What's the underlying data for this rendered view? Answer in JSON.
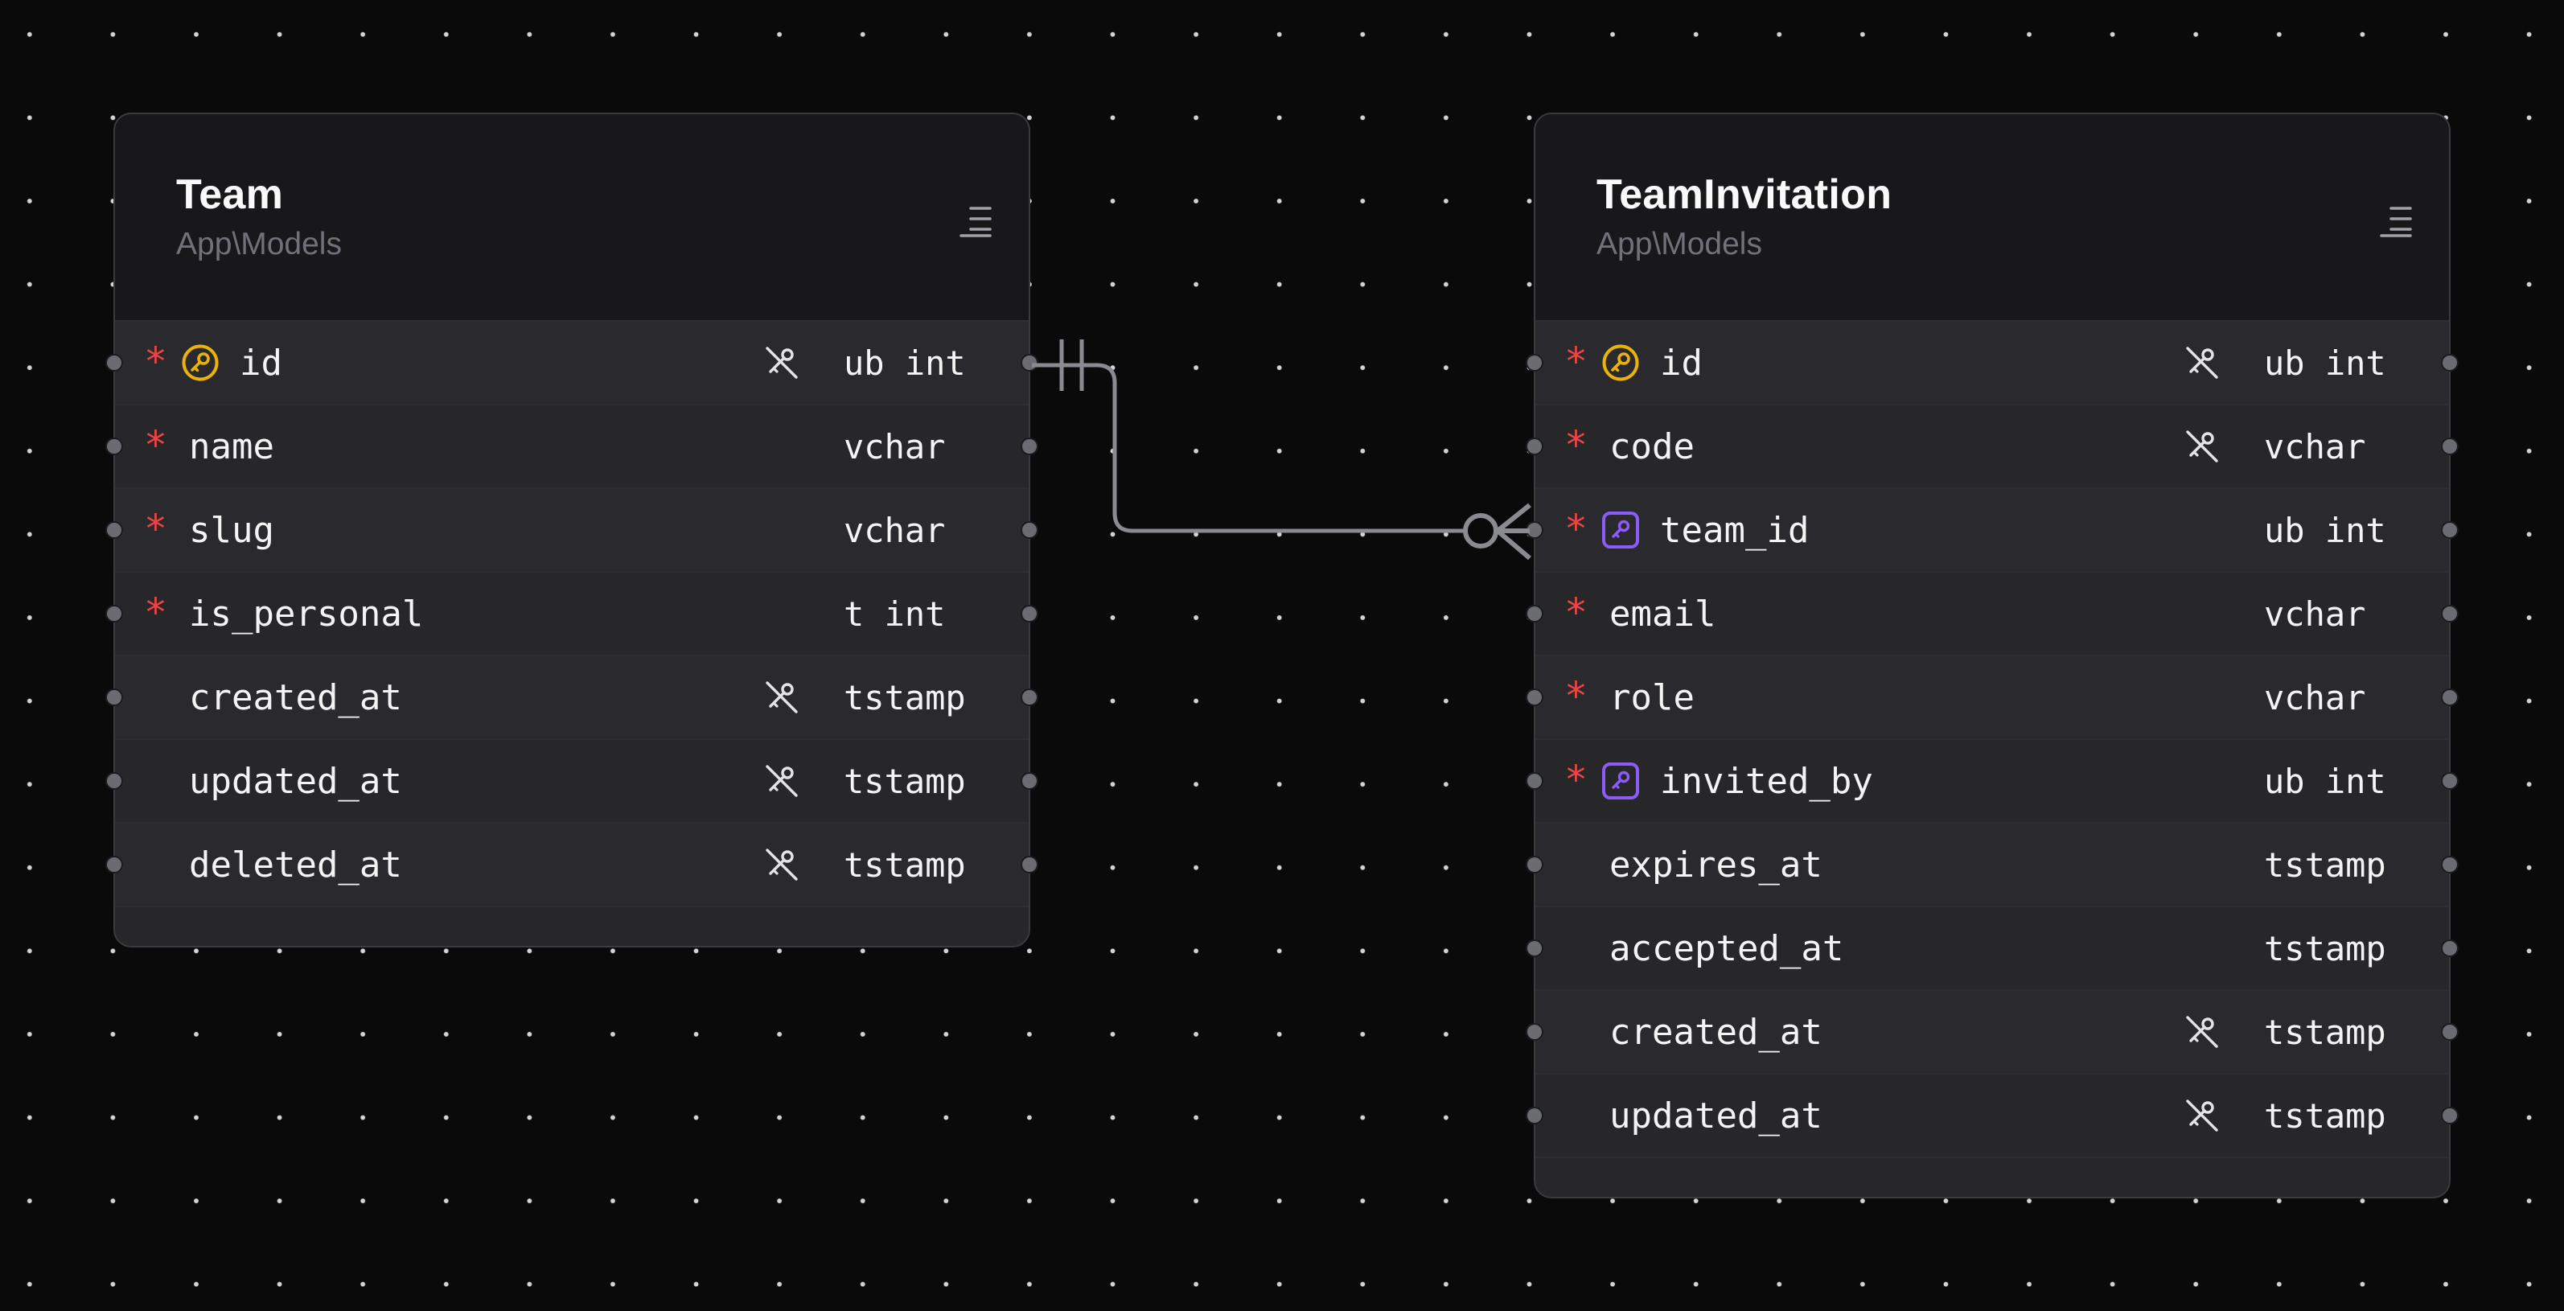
{
  "tables": [
    {
      "name": "Team",
      "namespace": "App\\Models",
      "columns": [
        {
          "name": "id",
          "type": "ub int",
          "required": true,
          "key": "primary",
          "no_key_icon": true
        },
        {
          "name": "name",
          "type": "vchar",
          "required": true,
          "key": "",
          "no_key_icon": false
        },
        {
          "name": "slug",
          "type": "vchar",
          "required": true,
          "key": "",
          "no_key_icon": false
        },
        {
          "name": "is_personal",
          "type": "t int",
          "required": true,
          "key": "",
          "no_key_icon": false
        },
        {
          "name": "created_at",
          "type": "tstamp",
          "required": false,
          "key": "",
          "no_key_icon": true
        },
        {
          "name": "updated_at",
          "type": "tstamp",
          "required": false,
          "key": "",
          "no_key_icon": true
        },
        {
          "name": "deleted_at",
          "type": "tstamp",
          "required": false,
          "key": "",
          "no_key_icon": true
        }
      ]
    },
    {
      "name": "TeamInvitation",
      "namespace": "App\\Models",
      "columns": [
        {
          "name": "id",
          "type": "ub int",
          "required": true,
          "key": "primary",
          "no_key_icon": true
        },
        {
          "name": "code",
          "type": "vchar",
          "required": true,
          "key": "",
          "no_key_icon": true
        },
        {
          "name": "team_id",
          "type": "ub int",
          "required": true,
          "key": "foreign",
          "no_key_icon": false
        },
        {
          "name": "email",
          "type": "vchar",
          "required": true,
          "key": "",
          "no_key_icon": false
        },
        {
          "name": "role",
          "type": "vchar",
          "required": true,
          "key": "",
          "no_key_icon": false
        },
        {
          "name": "invited_by",
          "type": "ub int",
          "required": true,
          "key": "foreign",
          "no_key_icon": false
        },
        {
          "name": "expires_at",
          "type": "tstamp",
          "required": false,
          "key": "",
          "no_key_icon": false
        },
        {
          "name": "accepted_at",
          "type": "tstamp",
          "required": false,
          "key": "",
          "no_key_icon": false
        },
        {
          "name": "created_at",
          "type": "tstamp",
          "required": false,
          "key": "",
          "no_key_icon": true
        },
        {
          "name": "updated_at",
          "type": "tstamp",
          "required": false,
          "key": "",
          "no_key_icon": true
        }
      ]
    }
  ],
  "relations": [
    {
      "from_table": "Team",
      "from_column": "id",
      "to_table": "TeamInvitation",
      "to_column": "team_id",
      "from_cardinality": "exactly-one",
      "to_cardinality": "zero-or-many"
    }
  ],
  "icons": {
    "required": "asterisk-icon",
    "primary_key": "primary-key-icon",
    "foreign_key": "foreign-key-icon",
    "no_key": "no-key-icon",
    "menu": "menu-icon"
  },
  "colors": {
    "background": "#0a0a0b",
    "required": "#ef4444",
    "primary_key": "#eab308",
    "foreign_key": "#8b5cf6",
    "edge": "#8a8a91"
  }
}
